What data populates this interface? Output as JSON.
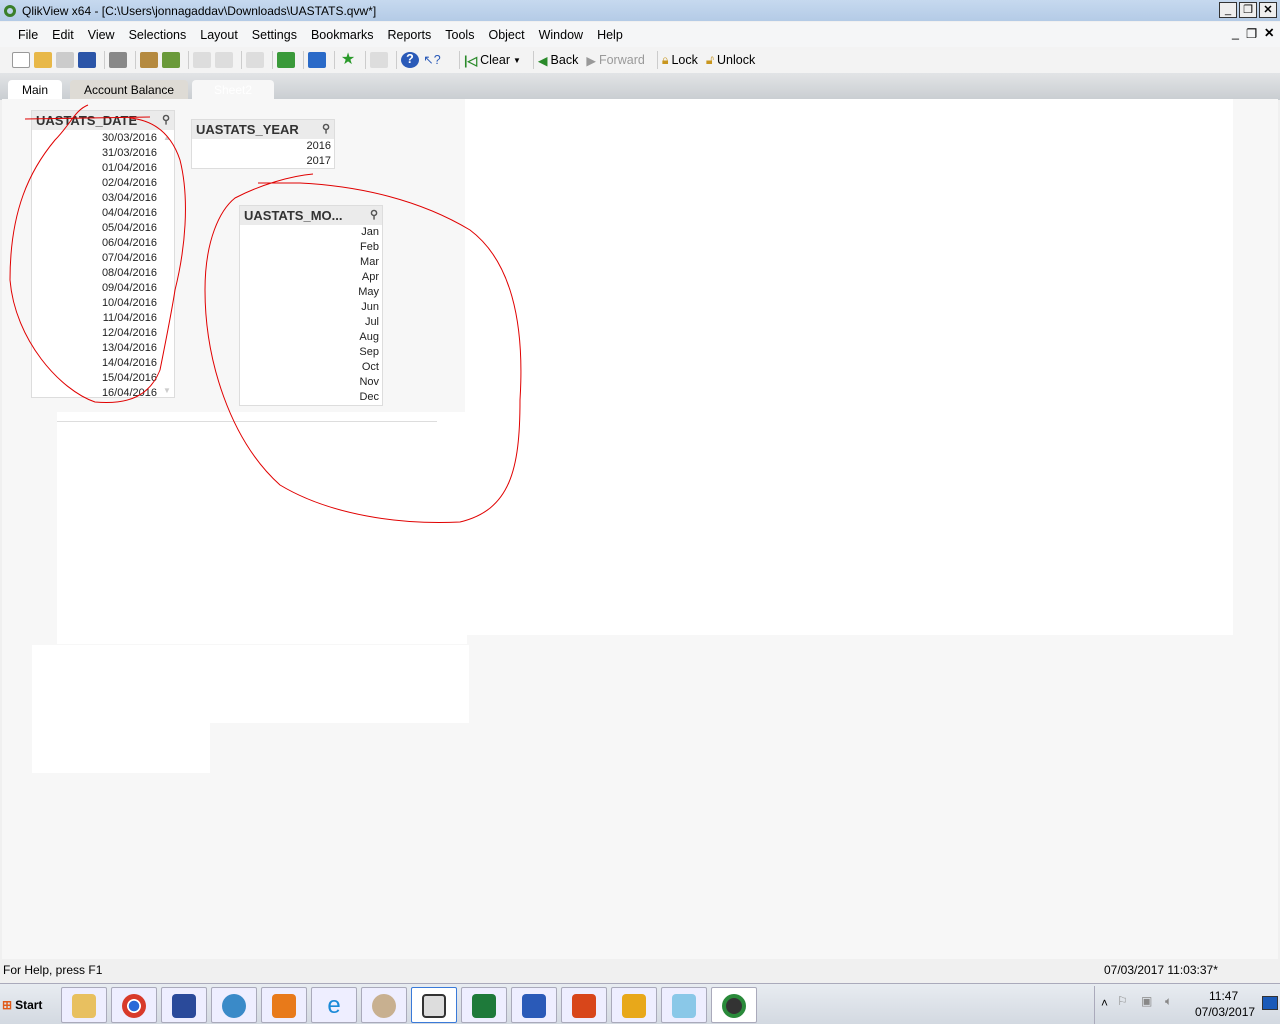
{
  "window": {
    "title": "QlikView x64 - [C:\\Users\\jonnagaddav\\Downloads\\UASTATS.qvw*]"
  },
  "menu": [
    "File",
    "Edit",
    "View",
    "Selections",
    "Layout",
    "Settings",
    "Bookmarks",
    "Reports",
    "Tools",
    "Object",
    "Window",
    "Help"
  ],
  "toolbar": {
    "clear": "Clear",
    "back": "Back",
    "forward": "Forward",
    "lock": "Lock",
    "unlock": "Unlock"
  },
  "tabs": [
    {
      "label": "Main"
    },
    {
      "label": "Account Balance"
    },
    {
      "label": "Sheet2",
      "active": true
    }
  ],
  "listboxes": {
    "date": {
      "title": "UASTATS_DATE",
      "values": [
        "30/03/2016",
        "31/03/2016",
        "01/04/2016",
        "02/04/2016",
        "03/04/2016",
        "04/04/2016",
        "05/04/2016",
        "06/04/2016",
        "07/04/2016",
        "08/04/2016",
        "09/04/2016",
        "10/04/2016",
        "11/04/2016",
        "12/04/2016",
        "13/04/2016",
        "14/04/2016",
        "15/04/2016",
        "16/04/2016"
      ]
    },
    "year": {
      "title": "UASTATS_YEAR",
      "values": [
        "2016",
        "2017"
      ]
    },
    "month": {
      "title": "UASTATS_MO...",
      "values": [
        "Jan",
        "Feb",
        "Mar",
        "Apr",
        "May",
        "Jun",
        "Jul",
        "Aug",
        "Sep",
        "Oct",
        "Nov",
        "Dec"
      ]
    }
  },
  "status": {
    "help": "For Help, press F1",
    "timestamp": "07/03/2017 11:03:37*"
  },
  "taskbar": {
    "start": "Start",
    "clock_time": "11:47",
    "clock_date": "07/03/2017"
  },
  "colors": {
    "annotation": "#e00000",
    "titlebar": "#b9d1ea"
  }
}
